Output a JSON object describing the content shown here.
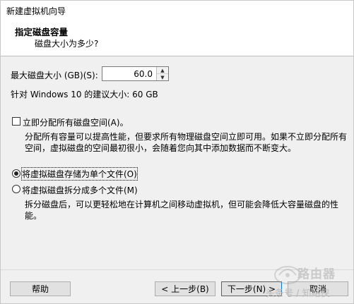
{
  "window": {
    "title": "新建虚拟机向导"
  },
  "header": {
    "title": "指定磁盘容量",
    "subtitle": "磁盘大小为多少?"
  },
  "disk_size": {
    "label": "最大磁盘大小 (GB)(S):",
    "value": "60.0",
    "recommendation": "针对 Windows 10 的建议大小: 60 GB"
  },
  "allocate": {
    "label": "立即分配所有磁盘空间(A)。",
    "checked": false,
    "description_line1": "分配所有容量可以提高性能，但要求所有物理磁盘空间立即可用。如果不立即分配所有",
    "description_line2": "空间，虚拟磁盘的空间最初很小，会随着您向其中添加数据而不断变大。"
  },
  "storage_options": [
    {
      "label": "将虚拟磁盘存储为单个文件(O)",
      "selected": true
    },
    {
      "label": "将虚拟磁盘拆分成多个文件(M)",
      "selected": false
    }
  ],
  "split_description_line1": "拆分磁盘后，可以更轻松地在计算机之间移动虚拟机，但可能会降低大容量磁盘的性",
  "split_description_line2": "能。",
  "buttons": {
    "help": "帮助",
    "back": "< 上一步(B)",
    "next": "下一步(N) >",
    "cancel": "取消"
  },
  "watermark": {
    "brand": "路由器",
    "text": "头条号 / 知路侠"
  },
  "colors": {
    "default_button_border": "#0078d7",
    "header_bg": "#ffffff",
    "body_bg": "#f0f0f0"
  }
}
